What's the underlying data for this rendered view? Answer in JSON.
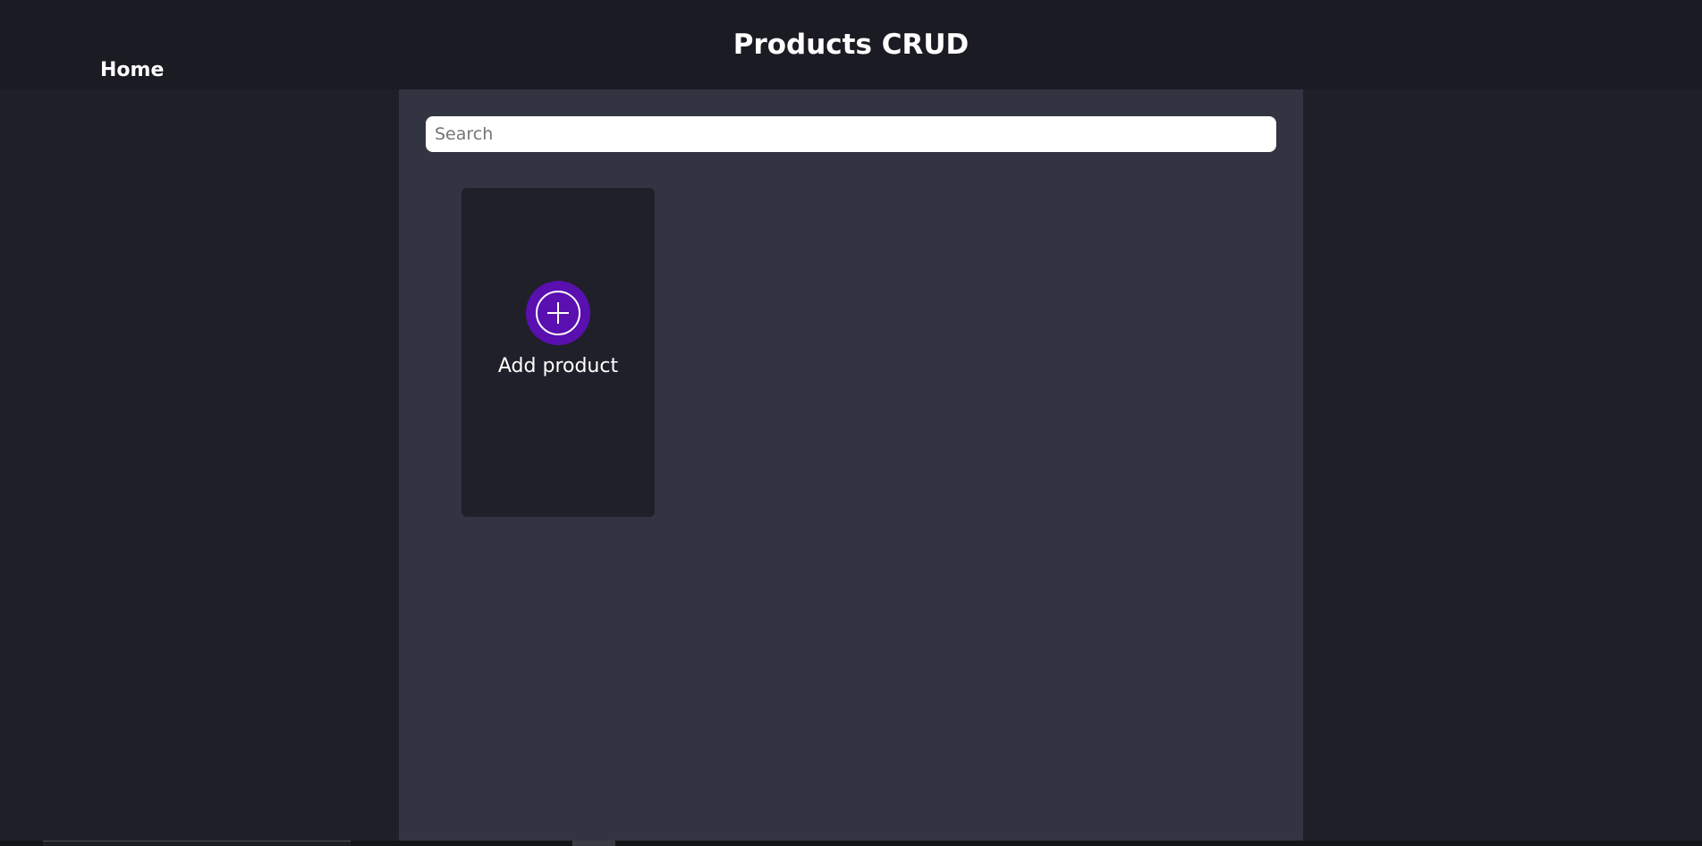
{
  "header": {
    "title": "Products CRUD",
    "home_link": "Home"
  },
  "search": {
    "placeholder": "Search",
    "value": ""
  },
  "add_card": {
    "label": "Add product",
    "icon": "plus-circle-icon"
  },
  "colors": {
    "header_bg": "#1a1b23",
    "page_bg": "#1e2028",
    "panel_bg": "#323541",
    "card_bg": "#1f2029",
    "accent": "#5a0fb0"
  }
}
